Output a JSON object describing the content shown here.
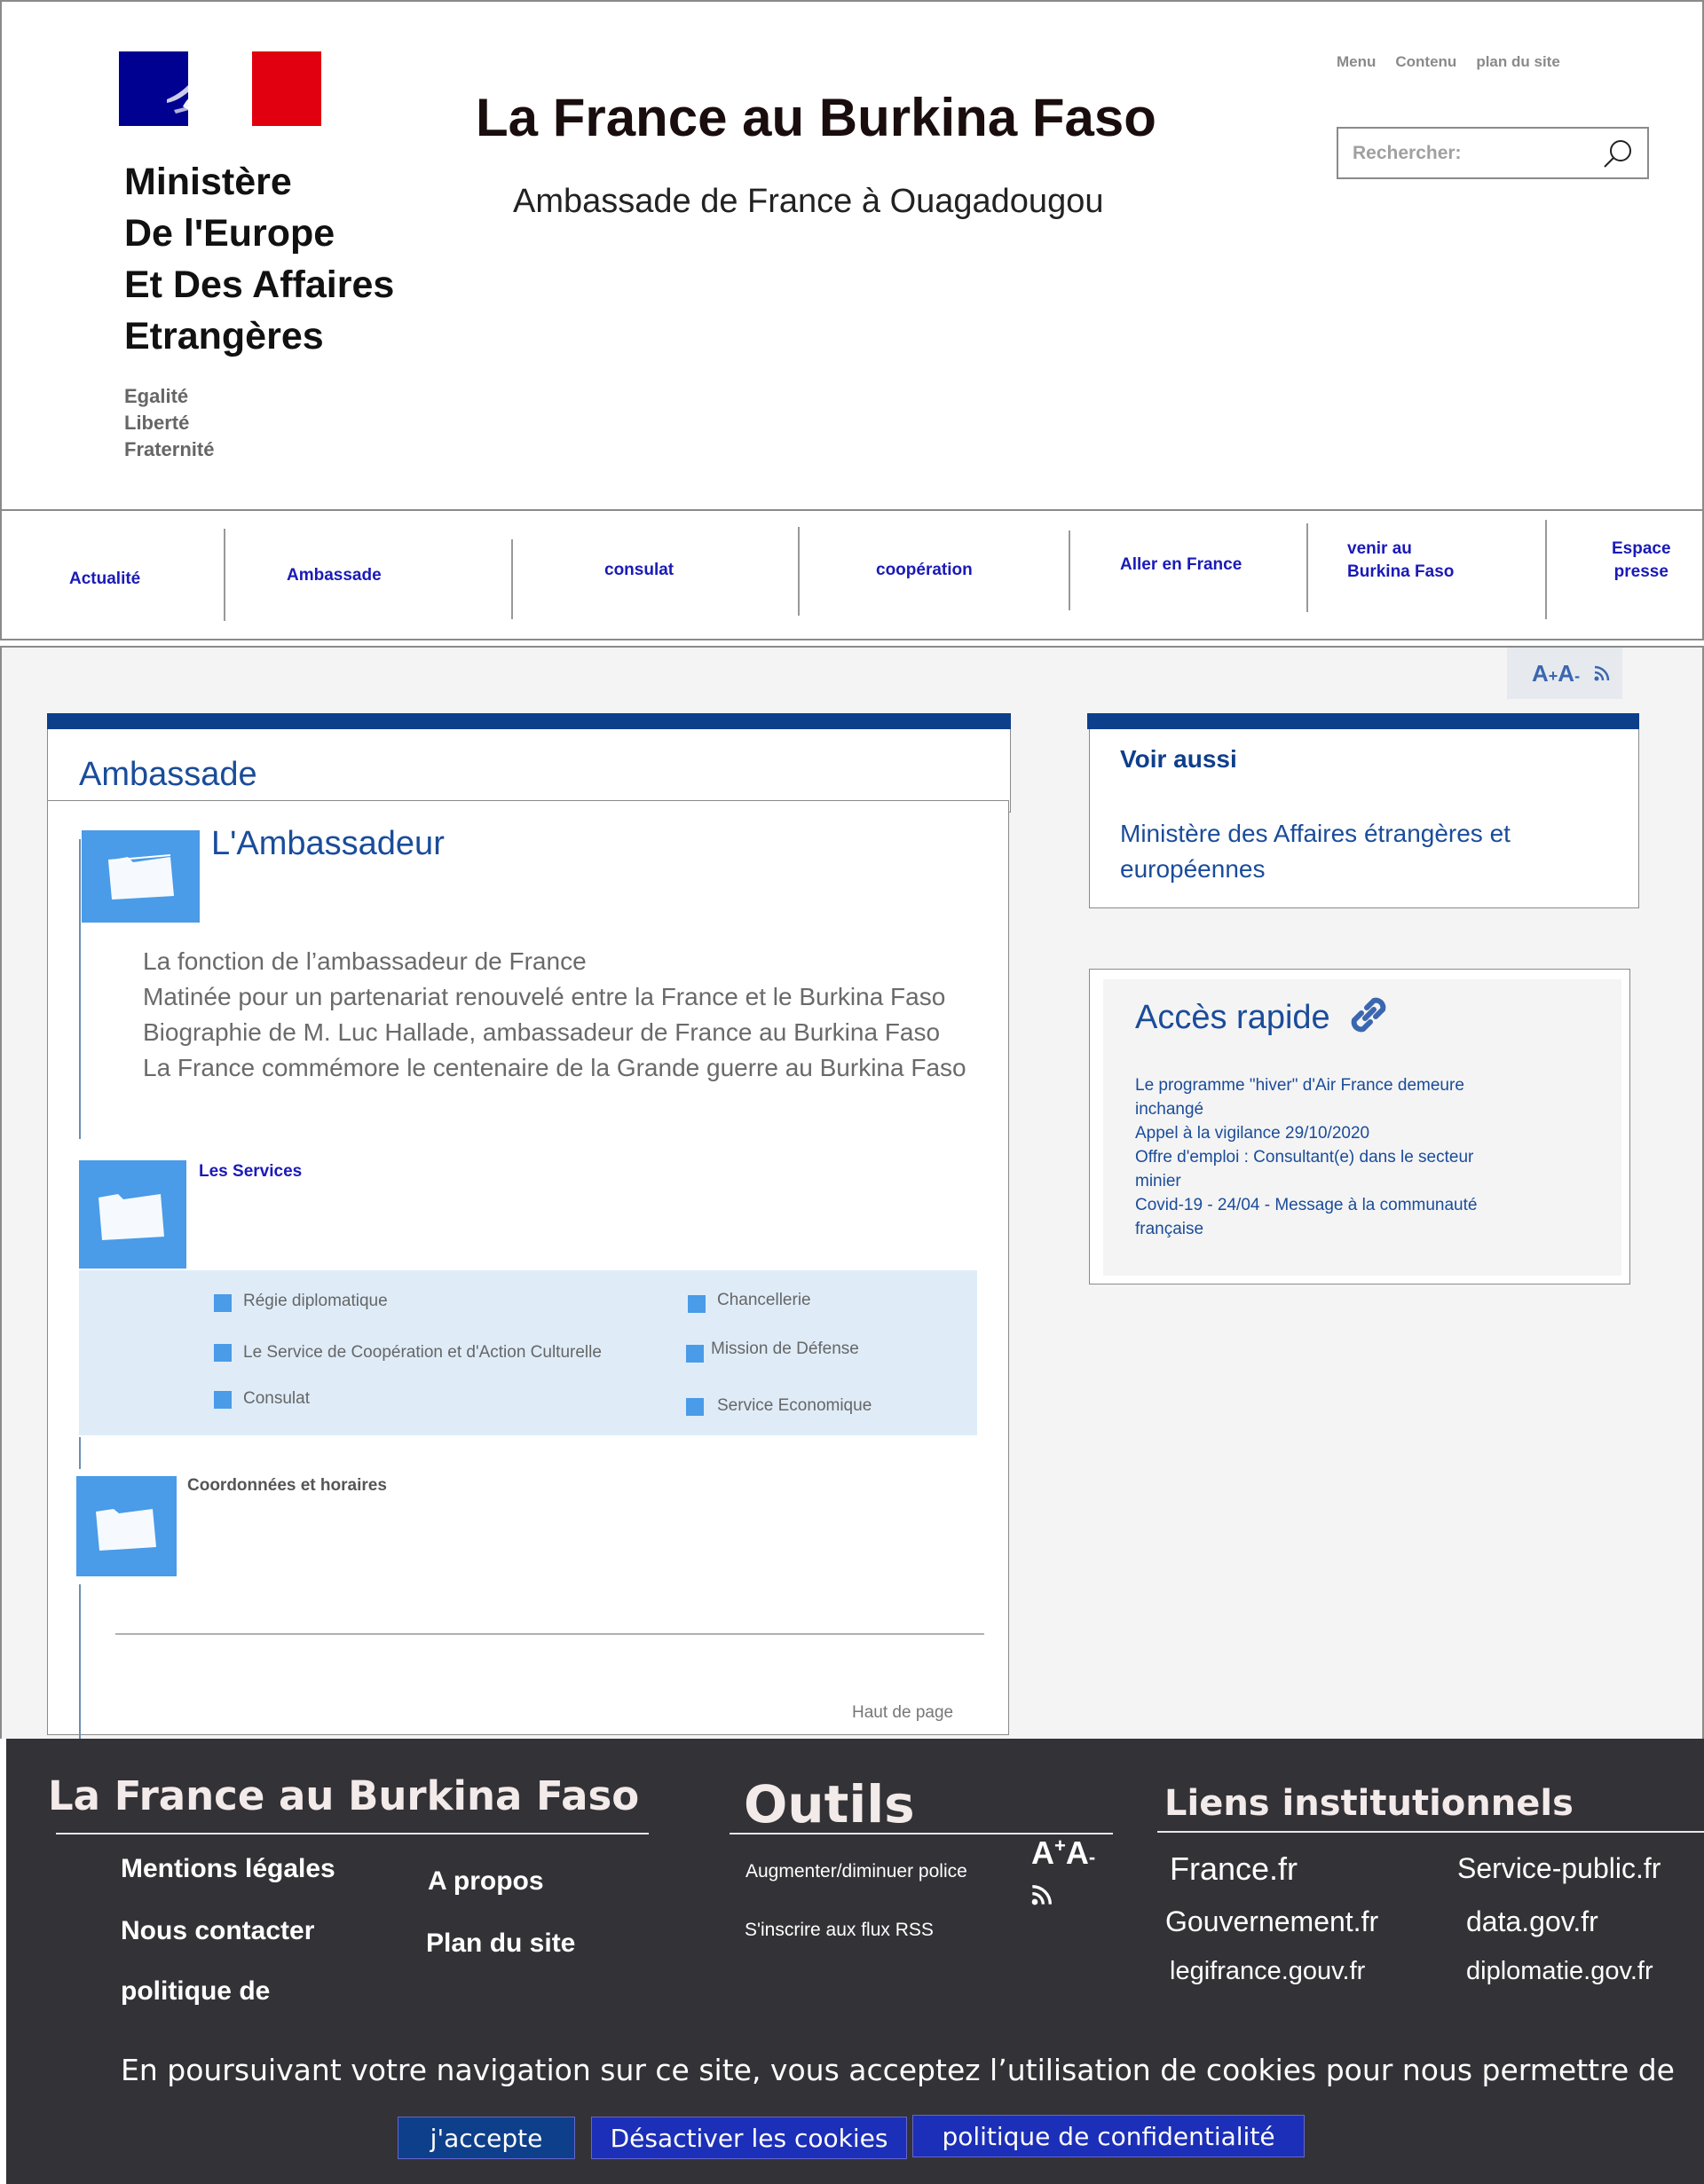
{
  "header": {
    "ministry_lines": [
      "Ministère",
      "De l'Europe",
      "Et Des Affaires",
      "Etrangères"
    ],
    "motto": [
      "Egalité",
      "Liberté",
      "Fraternité"
    ],
    "site_title": "La France au Burkina Faso",
    "site_subtitle": "Ambassade de France à Ouagadougou",
    "top_links": [
      "Menu",
      "Contenu",
      "plan du site"
    ],
    "search_placeholder": "Rechercher:",
    "flag_colors": {
      "blue": "#000091",
      "white": "#ffffff",
      "red": "#e1000f"
    }
  },
  "nav": {
    "items": [
      {
        "label": "Actualité"
      },
      {
        "label": "Ambassade"
      },
      {
        "label": "consulat"
      },
      {
        "label": "coopération"
      },
      {
        "label": "Aller en France"
      },
      {
        "label_lines": [
          "venir au",
          "Burkina Faso"
        ]
      },
      {
        "label_lines": [
          "Espace",
          "presse"
        ]
      }
    ]
  },
  "tools": {
    "font_icon": "A+A-",
    "rss_icon": "rss-icon"
  },
  "ambassade": {
    "title": "Ambassade",
    "ambassadeur": {
      "title": "L'Ambassadeur",
      "links": [
        "La fonction de l’ambassadeur de France",
        "Matinée pour un partenariat renouvelé entre la France et le Burkina Faso",
        "Biographie de M. Luc Hallade, ambassadeur de France au Burkina Faso",
        "La France commémore le centenaire de la Grande guerre au Burkina Faso"
      ]
    },
    "services": {
      "title": "Les Services",
      "left": [
        "Régie diplomatique",
        "Le Service de Coopération et d'Action Culturelle",
        "Consulat"
      ],
      "right": [
        "Chancellerie",
        "Mission de Défense",
        "Service Economique"
      ]
    },
    "coordonnees": {
      "title": "Coordonnées et horaires"
    },
    "back_to_top": "Haut de page"
  },
  "voir_aussi": {
    "title": "Voir aussi",
    "link": "Ministère des Affaires étrangères et européennes"
  },
  "acces_rapide": {
    "title": "Accès rapide",
    "links": [
      "Le programme \"hiver\" d'Air France demeure inchangé",
      "Appel à la vigilance 29/10/2020",
      "Offre d'emploi : Consultant(e) dans le secteur minier",
      "Covid-19 - 24/04 - Message à la communauté française"
    ]
  },
  "footer": {
    "col1_title": "La France au Burkina Faso",
    "col1_links": [
      "Mentions légales",
      "Nous contacter",
      "politique de",
      "A propos",
      "Plan du site"
    ],
    "col2_title": "Outils",
    "col2_links": [
      "Augmenter/diminuer police",
      "S'inscrire aux flux RSS"
    ],
    "col3_title": "Liens institutionnels",
    "col3_links": [
      "France.fr",
      "Service-public.fr",
      "Gouvernement.fr",
      "data.gov.fr",
      "legifrance.gouv.fr",
      "diplomatie.gov.fr"
    ],
    "cookie_text": "En poursuivant votre navigation sur ce site, vous acceptez l’utilisation de cookies pour nous permettre de",
    "cookie_buttons": [
      "j'accepte",
      "Désactiver les cookies",
      "politique de confidentialité"
    ],
    "colors": {
      "background": "#333236",
      "accept": "#0e3f8a",
      "other": "#1c2fb8"
    }
  }
}
